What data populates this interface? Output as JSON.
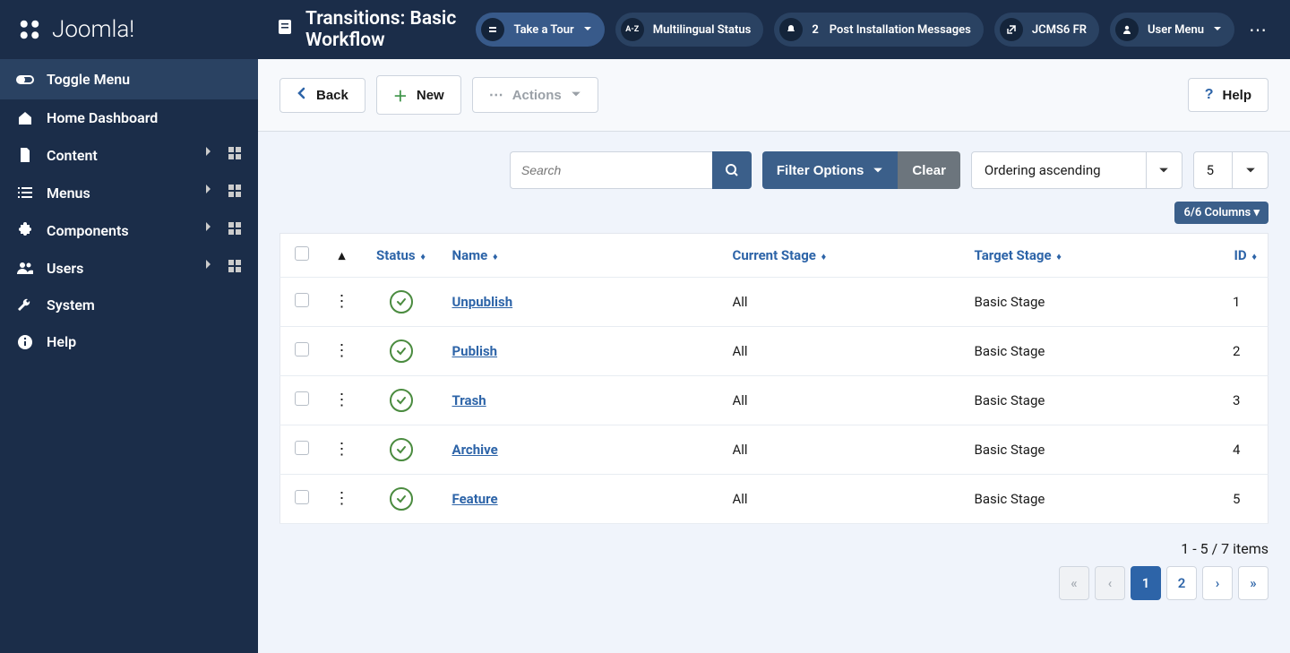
{
  "brand": "Joomla!",
  "sidebar": {
    "toggle_label": "Toggle Menu",
    "items": [
      {
        "icon": "home",
        "label": "Home Dashboard",
        "expandable": false
      },
      {
        "icon": "file",
        "label": "Content",
        "expandable": true
      },
      {
        "icon": "list",
        "label": "Menus",
        "expandable": true
      },
      {
        "icon": "puzzle",
        "label": "Components",
        "expandable": true
      },
      {
        "icon": "users",
        "label": "Users",
        "expandable": true
      },
      {
        "icon": "wrench",
        "label": "System",
        "expandable": false
      },
      {
        "icon": "info",
        "label": "Help",
        "expandable": false
      }
    ]
  },
  "header": {
    "title": "Transitions: Basic Workflow",
    "pills": {
      "tour": "Take a Tour",
      "multilingual": "Multilingual Status",
      "post_install_badge": "2",
      "post_install": "Post Installation Messages",
      "site_link": "JCMS6 FR",
      "user_menu": "User Menu"
    }
  },
  "toolbar": {
    "back": "Back",
    "new": "New",
    "actions": "Actions",
    "help": "Help"
  },
  "filters": {
    "search_placeholder": "Search",
    "filter_options": "Filter Options",
    "clear": "Clear",
    "ordering": "Ordering ascending",
    "limit": "5"
  },
  "columns_badge": "6/6 Columns",
  "table": {
    "headers": {
      "status": "Status",
      "name": "Name",
      "current": "Current Stage",
      "target": "Target Stage",
      "id": "ID"
    },
    "rows": [
      {
        "name": "Unpublish",
        "current": "All",
        "target": "Basic Stage",
        "id": "1"
      },
      {
        "name": "Publish",
        "current": "All",
        "target": "Basic Stage",
        "id": "2"
      },
      {
        "name": "Trash",
        "current": "All",
        "target": "Basic Stage",
        "id": "3"
      },
      {
        "name": "Archive",
        "current": "All",
        "target": "Basic Stage",
        "id": "4"
      },
      {
        "name": "Feature",
        "current": "All",
        "target": "Basic Stage",
        "id": "5"
      }
    ]
  },
  "footer": {
    "items_info": "1 - 5 / 7 items",
    "pages": [
      "1",
      "2"
    ],
    "active_page": "1"
  }
}
